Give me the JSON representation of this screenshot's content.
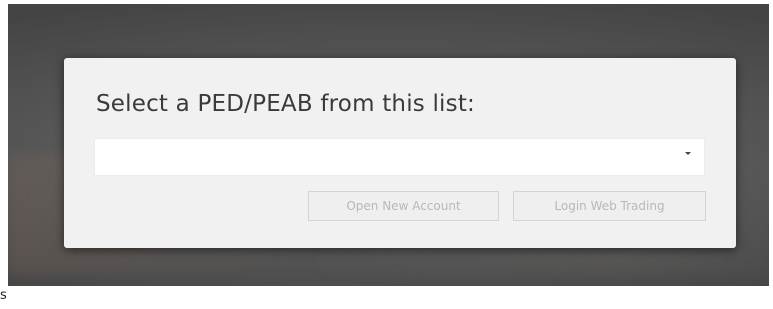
{
  "dialog": {
    "title": "Select a PED/PEAB from this list:",
    "select": {
      "value": "",
      "icon": "chevron-down-icon"
    },
    "buttons": {
      "open_account": "Open New Account",
      "login_web_trading": "Login Web Trading"
    }
  },
  "stray_text": "s"
}
